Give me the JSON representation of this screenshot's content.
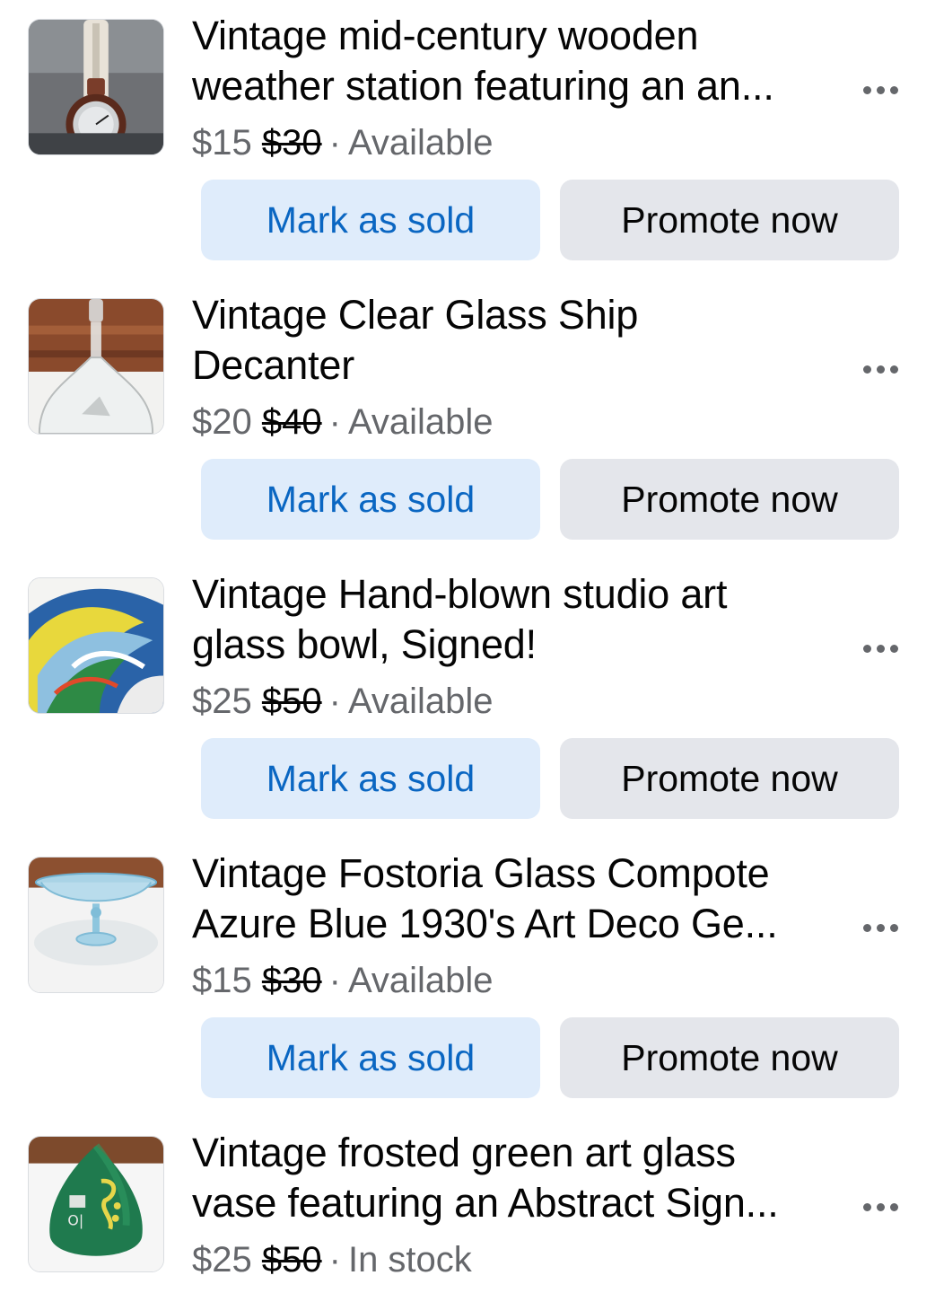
{
  "listings": [
    {
      "title_line1": "Vintage mid-century wooden",
      "title_line2": "weather station featuring an an...",
      "price": "$15",
      "original_price": "$30",
      "separator": "·",
      "status": "Available",
      "mark_sold_label": "Mark as sold",
      "promote_label": "Promote now",
      "thumbnail_icon": "weather-station-photo"
    },
    {
      "title_line1": "Vintage Clear Glass Ship",
      "title_line2": "Decanter",
      "price": "$20",
      "original_price": "$40",
      "separator": "·",
      "status": "Available",
      "mark_sold_label": "Mark as sold",
      "promote_label": "Promote now",
      "thumbnail_icon": "glass-decanter-photo"
    },
    {
      "title_line1": "Vintage Hand-blown studio art",
      "title_line2": "glass bowl, Signed!",
      "price": "$25",
      "original_price": "$50",
      "separator": "·",
      "status": "Available",
      "mark_sold_label": "Mark as sold",
      "promote_label": "Promote now",
      "thumbnail_icon": "art-glass-bowl-photo"
    },
    {
      "title_line1": "Vintage Fostoria Glass Compote",
      "title_line2": "Azure Blue 1930's Art Deco Ge...",
      "price": "$15",
      "original_price": "$30",
      "separator": "·",
      "status": "Available",
      "mark_sold_label": "Mark as sold",
      "promote_label": "Promote now",
      "thumbnail_icon": "glass-compote-photo"
    },
    {
      "title_line1": "Vintage frosted green art glass",
      "title_line2": "vase featuring an Abstract Sign...",
      "price": "$25",
      "original_price": "$50",
      "separator": "·",
      "status": "In stock",
      "thumbnail_icon": "green-vase-photo"
    }
  ],
  "colors": {
    "primary_text": "#050505",
    "secondary_text": "#65676b",
    "mark_sold_bg": "#dfecfb",
    "mark_sold_text": "#0a66c2",
    "promote_bg": "#e4e6eb"
  },
  "more_icon": "more-options-icon"
}
